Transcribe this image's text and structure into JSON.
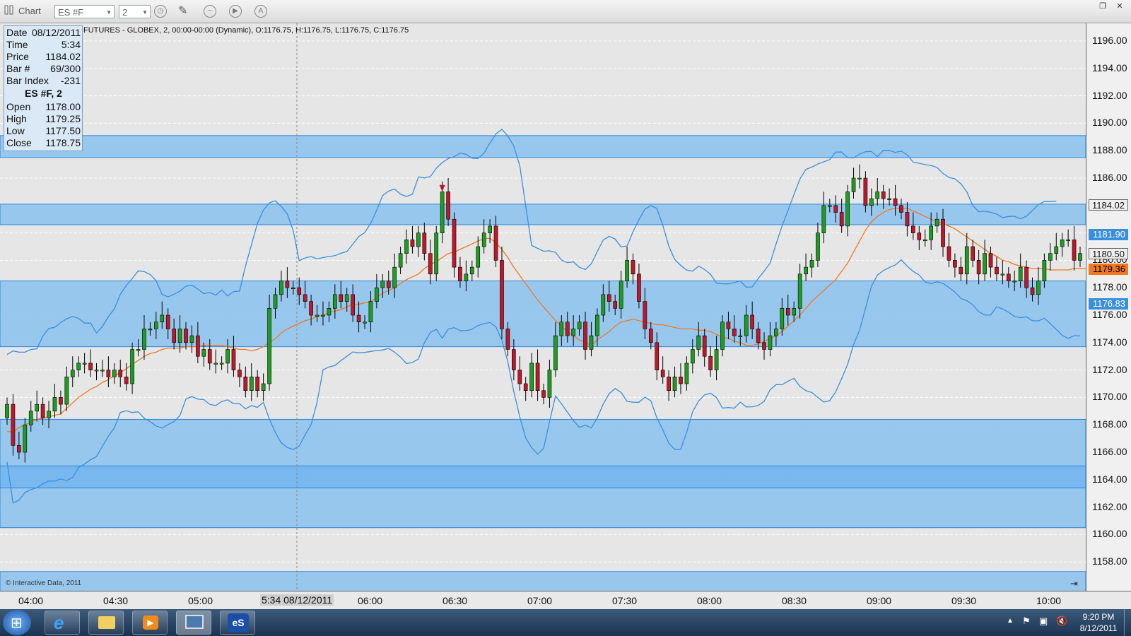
{
  "toolbar": {
    "title": "Chart",
    "symbol": "ES #F",
    "interval": "2"
  },
  "header": {
    "text": "FUTURES - GLOBEX, 2, 00:00-00:00 (Dynamic), O:1176.75, H:1176.75, L:1176.75, C:1176.75"
  },
  "info_panel": {
    "date_label": "Date",
    "date_value": "08/12/2011",
    "time_label": "Time",
    "time_value": "5:34",
    "price_label": "Price",
    "price_value": "1184.02",
    "bar_label": "Bar #",
    "bar_value": "69/300",
    "index_label": "Bar Index",
    "index_value": "-231",
    "symbol_title": "ES #F, 2",
    "open_label": "Open",
    "open_value": "1178.00",
    "high_label": "High",
    "high_value": "1179.25",
    "low_label": "Low",
    "low_value": "1177.50",
    "close_label": "Close",
    "close_value": "1178.75"
  },
  "copyright": "© Interactive Data, 2011",
  "colors": {
    "up": "#1e9e1e",
    "down": "#c0182a",
    "band": "#3a8fdc",
    "ma": "#f07820",
    "zone": "#8fc3ee",
    "zone_dark": "#6bb3f0"
  },
  "chart_data": {
    "type": "candlestick",
    "ylim": [
      1156.5,
      1197.5
    ],
    "price_ticks": [
      "1196.00",
      "1194.00",
      "1192.00",
      "1190.00",
      "1188.00",
      "1186.00",
      "1184.00",
      "1182.00",
      "1180.00",
      "1178.00",
      "1176.00",
      "1174.00",
      "1172.00",
      "1170.00",
      "1168.00",
      "1166.00",
      "1164.00",
      "1162.00",
      "1160.00",
      "1158.00"
    ],
    "time_ticks": [
      "04:00",
      "04:30",
      "05:00",
      "06:00",
      "06:30",
      "07:00",
      "07:30",
      "08:00",
      "08:30",
      "09:00",
      "09:30",
      "10:00"
    ],
    "crosshair_label": "5:34 08/12/2011",
    "price_tags": [
      {
        "label": "1184.02",
        "value": 1184.02,
        "style": "plain"
      },
      {
        "label": "1181.90",
        "value": 1181.9,
        "style": "band"
      },
      {
        "label": "1180.50",
        "value": 1180.5,
        "style": "plain"
      },
      {
        "label": "1179.36",
        "value": 1179.36,
        "style": "ma"
      },
      {
        "label": "1176.83",
        "value": 1176.83,
        "style": "band"
      }
    ],
    "zones": [
      {
        "top": 1189.1,
        "bottom": 1187.5
      },
      {
        "top": 1184.1,
        "bottom": 1182.6
      },
      {
        "top": 1178.5,
        "bottom": 1173.7
      },
      {
        "top": 1168.4,
        "bottom": 1165.0
      },
      {
        "top": 1165.0,
        "bottom": 1163.4
      },
      {
        "top": 1163.4,
        "bottom": 1160.5
      },
      {
        "top": 1157.3,
        "bottom": 1155.8
      }
    ],
    "closes": [
      1169.5,
      1166.5,
      1166.0,
      1168.0,
      1169.0,
      1169.5,
      1168.5,
      1169.0,
      1170.0,
      1169.5,
      1171.5,
      1172.0,
      1172.5,
      1172.5,
      1172.0,
      1172.0,
      1172.0,
      1171.5,
      1172.0,
      1171.5,
      1171.0,
      1173.5,
      1173.5,
      1175.0,
      1175.0,
      1175.5,
      1176.0,
      1175.0,
      1174.0,
      1175.0,
      1174.0,
      1174.5,
      1173.0,
      1173.5,
      1172.5,
      1172.5,
      1172.5,
      1173.5,
      1172.0,
      1171.5,
      1170.5,
      1171.5,
      1170.5,
      1171.0,
      1176.5,
      1177.5,
      1178.5,
      1178.0,
      1178.0,
      1177.5,
      1177.0,
      1176.0,
      1176.0,
      1176.0,
      1176.5,
      1177.5,
      1177.0,
      1177.5,
      1176.0,
      1175.5,
      1175.5,
      1177.0,
      1178.0,
      1178.5,
      1178.0,
      1179.5,
      1180.5,
      1181.5,
      1181.0,
      1182.0,
      1180.5,
      1179.0,
      1182.0,
      1185.0,
      1183.0,
      1179.5,
      1178.5,
      1179.0,
      1179.5,
      1181.0,
      1182.0,
      1182.5,
      1180.0,
      1175.0,
      1173.5,
      1172.0,
      1171.0,
      1170.5,
      1172.5,
      1170.5,
      1170.0,
      1172.0,
      1174.5,
      1175.5,
      1174.5,
      1175.0,
      1175.5,
      1173.5,
      1174.5,
      1176.0,
      1177.5,
      1177.0,
      1176.5,
      1178.5,
      1180.0,
      1179.0,
      1177.0,
      1175.0,
      1174.0,
      1172.0,
      1171.5,
      1170.5,
      1171.5,
      1171.0,
      1172.5,
      1173.5,
      1174.5,
      1173.0,
      1172.0,
      1173.5,
      1175.5,
      1175.0,
      1174.5,
      1174.5,
      1176.0,
      1175.0,
      1174.0,
      1173.5,
      1174.5,
      1175.0,
      1176.5,
      1176.0,
      1176.5,
      1179.0,
      1179.5,
      1180.0,
      1182.0,
      1184.0,
      1184.0,
      1183.5,
      1182.5,
      1185.0,
      1186.0,
      1186.0,
      1184.0,
      1184.5,
      1185.0,
      1184.5,
      1184.5,
      1184.0,
      1183.5,
      1182.5,
      1182.0,
      1181.5,
      1181.5,
      1182.5,
      1183.0,
      1181.0,
      1180.0,
      1179.5,
      1179.0,
      1181.0,
      1180.0,
      1179.0,
      1180.5,
      1179.5,
      1179.0,
      1179.0,
      1178.5,
      1178.5,
      1179.5,
      1178.0,
      1177.5,
      1178.5,
      1180.0,
      1180.5,
      1181.0,
      1181.5,
      1181.5,
      1180.0,
      1180.5
    ],
    "ma_values": [
      1167.5,
      1167.5,
      1167.8,
      1168.0,
      1168.2,
      1168.4,
      1168.5,
      1168.6,
      1168.7,
      1168.8,
      1169.2,
      1169.6,
      1170.0,
      1170.3,
      1170.6,
      1170.8,
      1171.1,
      1171.3,
      1171.6,
      1171.8,
      1172.1,
      1172.4,
      1172.7,
      1173.0,
      1173.2,
      1173.3,
      1173.5,
      1173.6,
      1173.6,
      1173.6,
      1173.7,
      1173.7,
      1173.7,
      1173.8,
      1173.8,
      1173.8,
      1173.8,
      1173.7,
      1173.6,
      1173.5,
      1173.5,
      1173.4,
      1173.5,
      1173.7,
      1174.0,
      1174.3,
      1174.7,
      1175.0,
      1175.2,
      1175.4,
      1175.6,
      1175.7,
      1175.9,
      1176.0,
      1176.2,
      1176.3,
      1176.4,
      1176.6,
      1176.8,
      1176.8,
      1176.9,
      1177.0,
      1177.3,
      1177.6,
      1177.8,
      1178.0,
      1178.3,
      1178.6,
      1178.8,
      1179.0,
      1179.4,
      1179.7,
      1179.9,
      1180.2,
      1180.5,
      1180.6,
      1180.8,
      1181.0,
      1181.2,
      1181.4,
      1181.6,
      1181.6,
      1181.3,
      1180.8,
      1180.2,
      1179.5,
      1178.9,
      1178.3,
      1177.7,
      1177.1,
      1176.6,
      1176.1,
      1175.6,
      1175.2,
      1174.8,
      1174.5,
      1174.2,
      1174.0,
      1173.8,
      1174.2,
      1174.5,
      1174.8,
      1175.2,
      1175.5,
      1175.6,
      1175.7,
      1175.6,
      1175.5,
      1175.4,
      1175.3,
      1175.3,
      1175.2,
      1175.1,
      1175.0,
      1175.0,
      1175.0,
      1174.9,
      1174.9,
      1174.8,
      1174.6,
      1174.4,
      1174.3,
      1174.1,
      1174.0,
      1173.8,
      1173.8,
      1173.9,
      1174.1,
      1174.3,
      1174.5,
      1174.8,
      1175.2,
      1175.6,
      1176.0,
      1176.5,
      1177.0,
      1177.4,
      1177.8,
      1178.2,
      1178.6,
      1179.2,
      1179.8,
      1180.6,
      1181.4,
      1182.2,
      1182.8,
      1183.2,
      1183.5,
      1183.7,
      1183.8,
      1183.8,
      1183.8,
      1183.6,
      1183.4,
      1183.2,
      1183.0,
      1182.8,
      1182.7,
      1182.5,
      1182.3,
      1182.0,
      1181.7,
      1181.4,
      1181.1,
      1180.8,
      1180.5,
      1180.3,
      1180.0,
      1179.9,
      1179.7,
      1179.6,
      1179.5,
      1179.4,
      1179.4,
      1179.4,
      1179.3,
      1179.3,
      1179.3,
      1179.3,
      1179.4,
      1179.4,
      1179.4,
      1179.4
    ]
  },
  "taskbar": {
    "clock_time": "9:20 PM",
    "clock_date": "8/12/2011"
  }
}
